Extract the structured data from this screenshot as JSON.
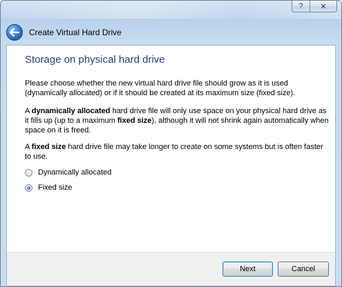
{
  "window": {
    "caption_help": "?",
    "caption_close": "✕"
  },
  "header": {
    "title": "Create Virtual Hard Drive"
  },
  "page": {
    "title": "Storage on physical hard drive",
    "paragraph1": "Please choose whether the new virtual hard drive file should grow as it is used (dynamically allocated) or if it should be created at its maximum size (fixed size).",
    "paragraph2": {
      "t1": "A ",
      "b1": "dynamically allocated",
      "t2": " hard drive file will only use space on your physical hard drive as it fills up (up to a maximum ",
      "b2": "fixed size",
      "t3": "), although it will not shrink again automatically when space on it is freed."
    },
    "paragraph3": {
      "t1": "A ",
      "b1": "fixed size",
      "t2": " hard drive file may take longer to create on some systems but is often faster to use."
    }
  },
  "options": [
    {
      "label": "Dynamically allocated",
      "selected": false
    },
    {
      "label": "Fixed size",
      "selected": true
    }
  ],
  "buttons": {
    "next": "Next",
    "cancel": "Cancel"
  }
}
